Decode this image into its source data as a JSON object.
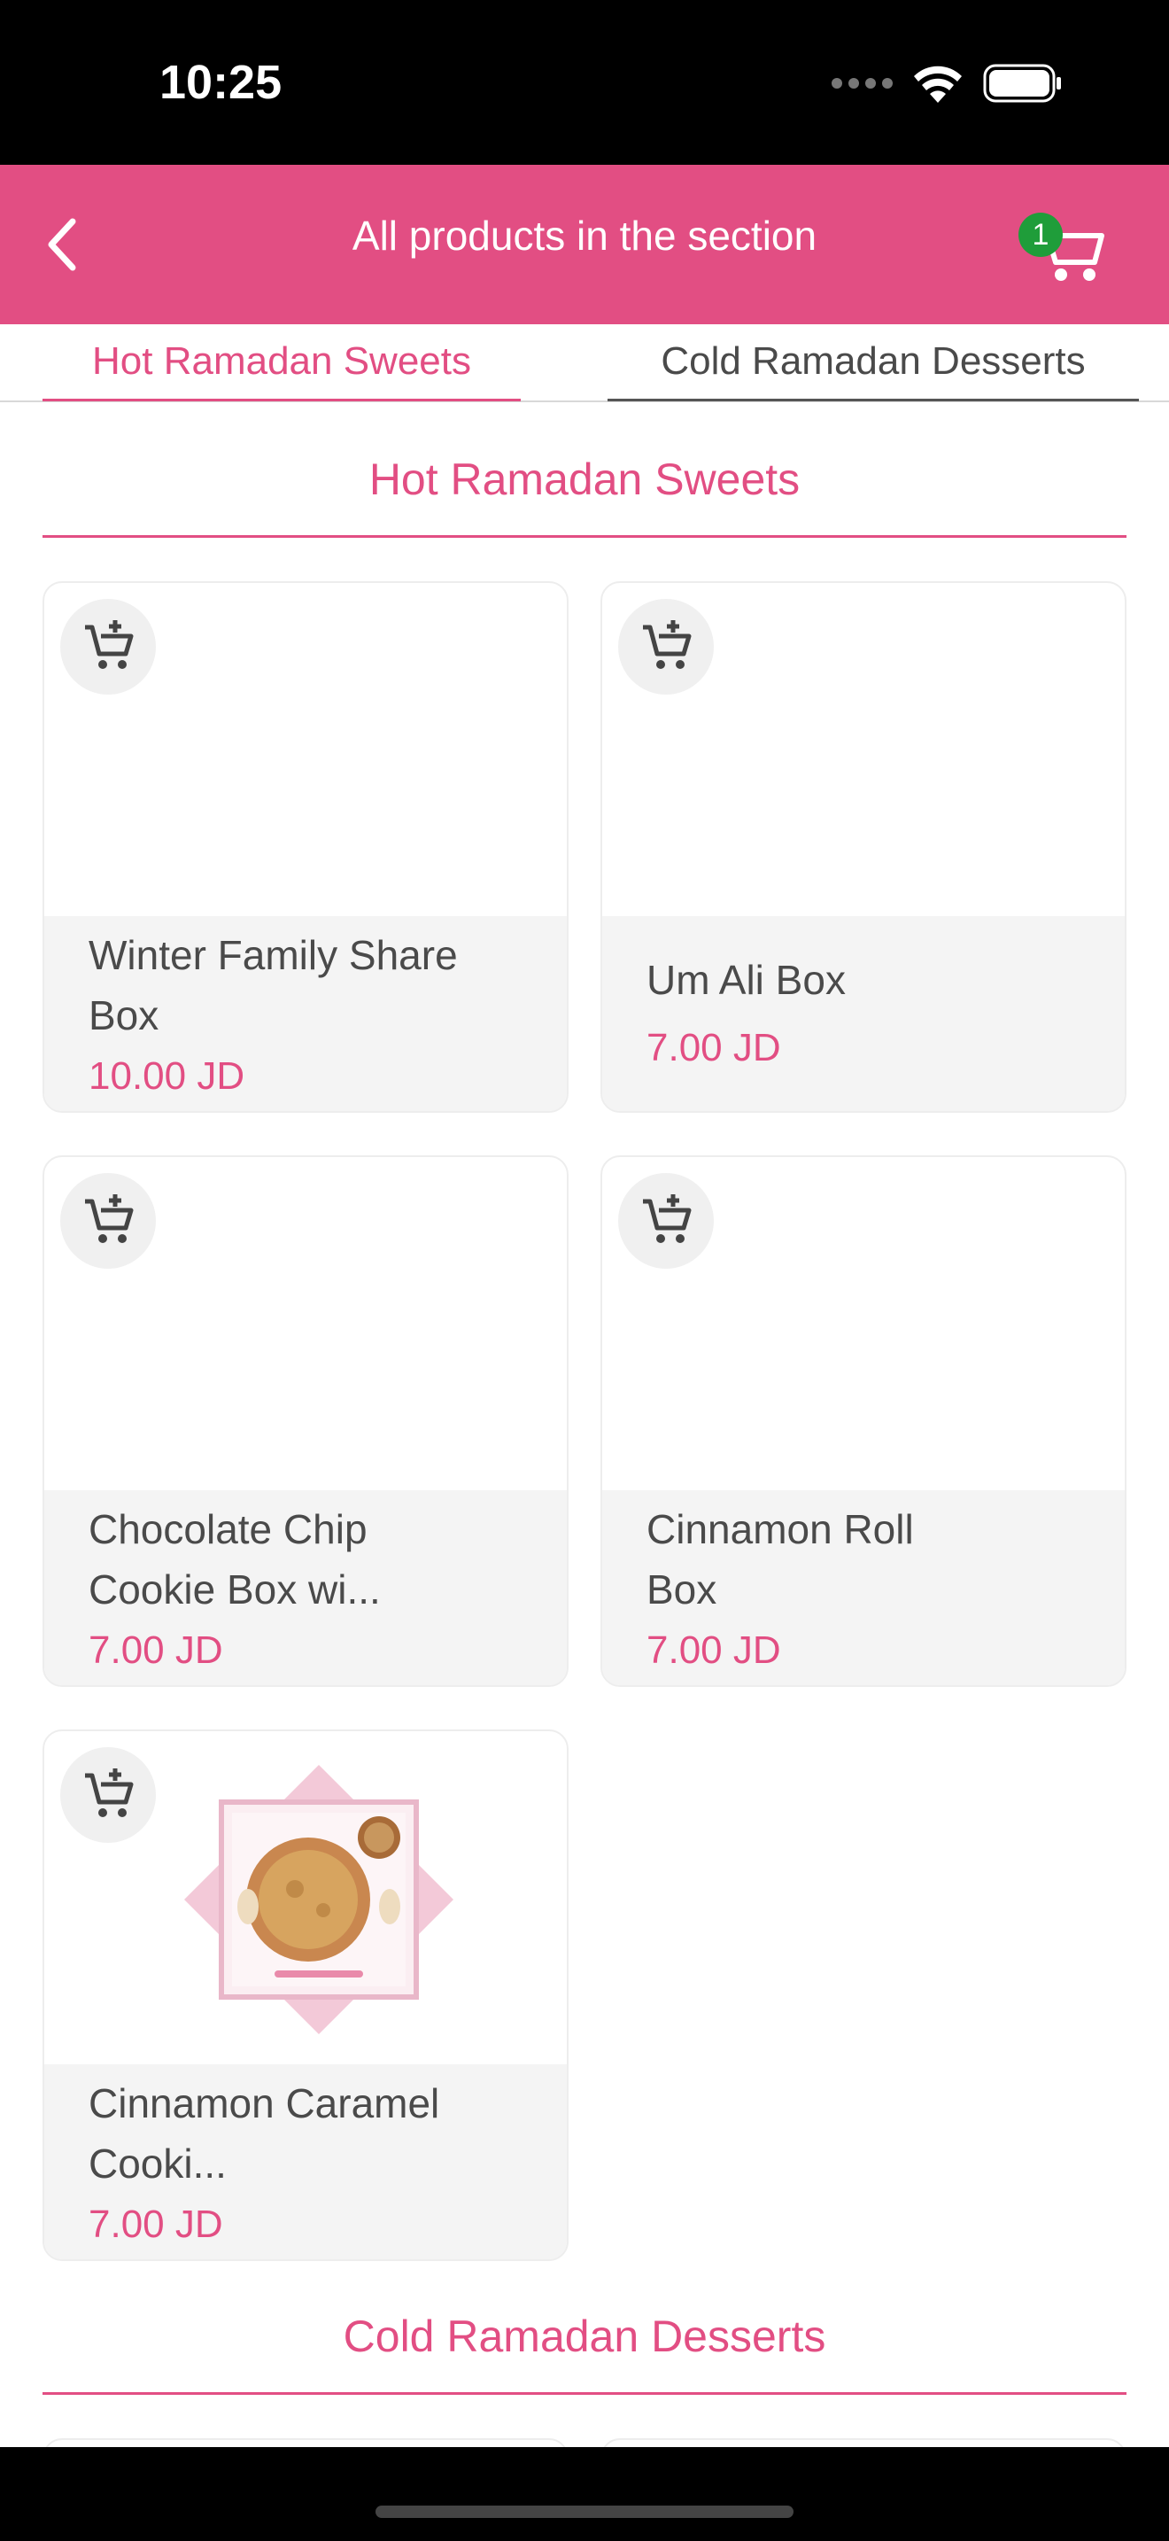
{
  "status_bar": {
    "time": "10:25"
  },
  "header": {
    "title": "All products in the section",
    "cart_count": "1"
  },
  "tabs": [
    {
      "label": "Hot Ramadan Sweets",
      "active": true
    },
    {
      "label": "Cold Ramadan Desserts",
      "active": false
    }
  ],
  "sections": [
    {
      "title": "Hot Ramadan Sweets",
      "products": [
        {
          "name": "Winter Family Share Box",
          "price": "10.00 JD"
        },
        {
          "name": "Um Ali Box",
          "price": "7.00 JD"
        },
        {
          "name": "Chocolate Chip Cookie Box wi...",
          "price": "7.00 JD"
        },
        {
          "name": "Cinnamon Roll Box",
          "price": "7.00 JD"
        },
        {
          "name": "Cinnamon Caramel Cooki...",
          "price": "7.00 JD"
        }
      ]
    },
    {
      "title": "Cold Ramadan Desserts"
    }
  ],
  "colors": {
    "accent": "#e24e83",
    "badge": "#1f9d3a"
  }
}
